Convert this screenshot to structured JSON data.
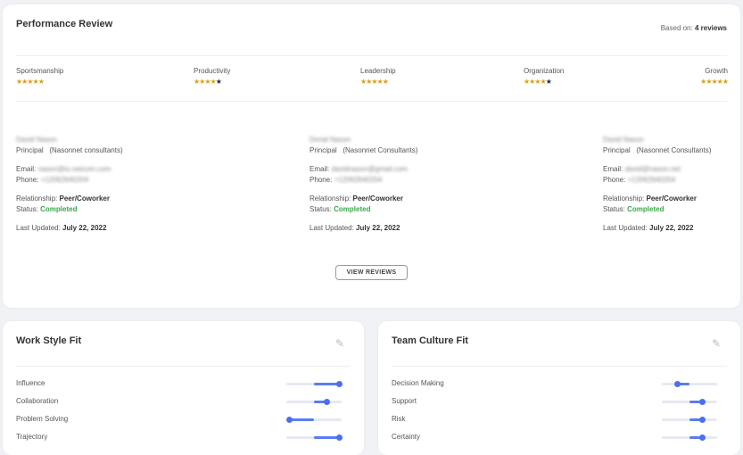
{
  "performance": {
    "title": "Performance Review",
    "based_on_label": "Based on:",
    "based_on_value": "4 reviews",
    "categories": [
      {
        "label": "Sportsmanship",
        "rating": 5
      },
      {
        "label": "Productivity",
        "rating": 4
      },
      {
        "label": "Leadership",
        "rating": 5
      },
      {
        "label": "Organization",
        "rating": 4
      },
      {
        "label": "Growth",
        "rating": 5
      }
    ],
    "reviewers": [
      {
        "name": "David Nason",
        "role": "Principal",
        "company": "(Nasonnet consultants)",
        "email_label": "Email:",
        "email": "nason@iu.netcom.com",
        "phone_label": "Phone:",
        "phone": "+12062640204",
        "relationship_label": "Relationship:",
        "relationship": "Peer/Coworker",
        "status_label": "Status:",
        "status": "Completed",
        "updated_label": "Last Updated:",
        "updated": "July 22, 2022"
      },
      {
        "name": "Donal Nason",
        "role": "Principal",
        "company": "(Nasonnet Consultants)",
        "email_label": "Email:",
        "email": "davidnason@gmail.com",
        "phone_label": "Phone:",
        "phone": "+12062640204",
        "relationship_label": "Relationship:",
        "relationship": "Peer/Coworker",
        "status_label": "Status:",
        "status": "Completed",
        "updated_label": "Last Updated:",
        "updated": "July 22, 2022"
      },
      {
        "name": "David Nason",
        "role": "Principal",
        "company": "(Nasonnet Consultants)",
        "email_label": "Email:",
        "email": "david@nason.net",
        "phone_label": "Phone:",
        "phone": "+12062640204",
        "relationship_label": "Relationship:",
        "relationship": "Peer/Coworker",
        "status_label": "Status:",
        "status": "Completed",
        "updated_label": "Last Updated:",
        "updated": "July 22, 2022"
      }
    ],
    "view_button": "VIEW REVIEWS"
  },
  "work_style": {
    "title": "Work Style Fit",
    "items": [
      {
        "label": "Influence",
        "value": 1
      },
      {
        "label": "Collaboration",
        "value": 0.5
      },
      {
        "label": "Problem Solving",
        "value": -1
      },
      {
        "label": "Trajectory",
        "value": 1
      }
    ]
  },
  "team_culture": {
    "title": "Team Culture Fit",
    "items": [
      {
        "label": "Decision Making",
        "value": -0.5
      },
      {
        "label": "Support",
        "value": 0.5
      },
      {
        "label": "Risk",
        "value": 0.5
      },
      {
        "label": "Certainty",
        "value": 0.5
      }
    ]
  },
  "colors": {
    "accent": "#5b7cf2",
    "star": "#d9a010",
    "status": "#3aa84a"
  }
}
